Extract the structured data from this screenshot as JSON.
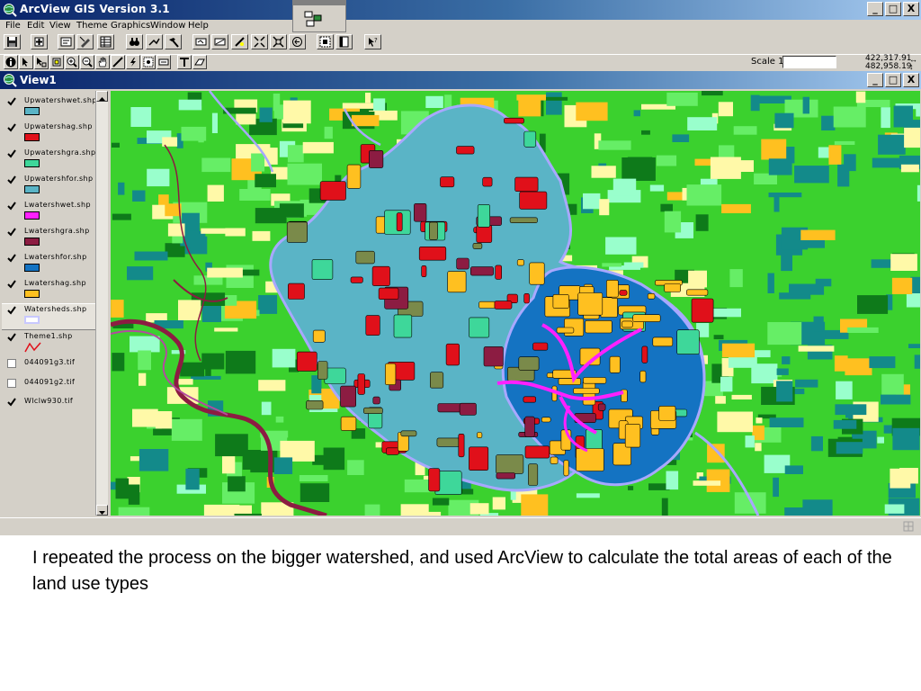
{
  "app": {
    "title": "ArcView GIS Version 3.1",
    "window_controls": [
      "_",
      "□",
      "X"
    ]
  },
  "menu": [
    "File",
    "Edit",
    "View",
    "Theme",
    "Graphics",
    "Window",
    "Help"
  ],
  "toolbar": {
    "scale_label": "Scale 1:",
    "scale_value": "",
    "coord_x": "422,317.91",
    "coord_y": "482,958.19"
  },
  "view": {
    "title": "View1"
  },
  "legend": [
    {
      "label": "Upwatershwet.shp",
      "checked": true,
      "color": "#5ab4c6"
    },
    {
      "label": "Upwatershag.shp",
      "checked": true,
      "color": "#e0101a"
    },
    {
      "label": "Upwatershgra.shp",
      "checked": true,
      "color": "#3ed79a"
    },
    {
      "label": "Upwatershfor.shp",
      "checked": true,
      "color": "#5ab4c6"
    },
    {
      "label": "Lwatershwet.shp",
      "checked": true,
      "color": "#ff20ff"
    },
    {
      "label": "Lwatershgra.shp",
      "checked": true,
      "color": "#8c1c42"
    },
    {
      "label": "Lwatershfor.shp",
      "checked": true,
      "color": "#1473c2"
    },
    {
      "label": "Lwatershag.shp",
      "checked": true,
      "color": "#ffc020"
    },
    {
      "label": "Watersheds.shp",
      "checked": true,
      "color": "#c8c8ff",
      "outline": true
    },
    {
      "label": "Theme1.shp",
      "checked": true,
      "color": "#e0101a",
      "line": true
    },
    {
      "label": "044091g3.tif",
      "checked": false
    },
    {
      "label": "044091g2.tif",
      "checked": false
    },
    {
      "label": "Wlclw930.tif",
      "checked": true
    }
  ],
  "colors": {
    "map_green": "#3bd12e",
    "dark_green": "#0e7a1a",
    "yellow": "#fff9a8",
    "orange": "#ffc020",
    "teal": "#138a8a",
    "watershed_up": "#5ab4c6",
    "watershed_low": "#1473c2",
    "red": "#e0101a",
    "magenta": "#ff20ff",
    "river": "#8c1c42"
  },
  "caption": "I repeated the process on the bigger watershed, and used ArcView to calculate the total areas of each of the land use types"
}
